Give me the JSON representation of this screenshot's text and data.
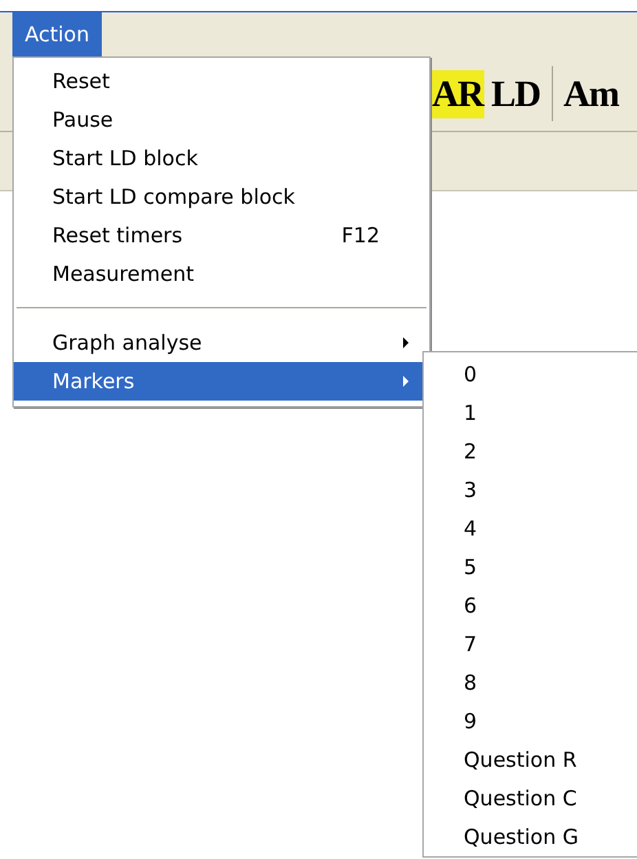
{
  "menubar": [
    {
      "label": "Action",
      "selected": true
    }
  ],
  "toolbar": [
    {
      "label": "AR",
      "highlighted": true
    },
    {
      "label": "LD",
      "highlighted": false
    },
    {
      "kind": "separator"
    },
    {
      "label": "Am",
      "highlighted": false
    }
  ],
  "menu": [
    {
      "kind": "item",
      "label": "Reset",
      "selected": false
    },
    {
      "kind": "item",
      "label": "Pause",
      "selected": false
    },
    {
      "kind": "item",
      "label": "Start LD block",
      "selected": false
    },
    {
      "kind": "item",
      "label": "Start LD compare block",
      "selected": false
    },
    {
      "kind": "item",
      "label": "Reset timers",
      "shortcut": "F12",
      "selected": false
    },
    {
      "kind": "item",
      "label": "Measurement",
      "selected": false
    },
    {
      "kind": "separator"
    },
    {
      "kind": "item",
      "label": "Graph analyse",
      "submenu": true,
      "selected": false
    },
    {
      "kind": "item",
      "label": "Markers",
      "submenu": true,
      "selected": true
    }
  ],
  "submenu": [
    {
      "label": "0"
    },
    {
      "label": "1"
    },
    {
      "label": "2"
    },
    {
      "label": "3"
    },
    {
      "label": "4"
    },
    {
      "label": "5"
    },
    {
      "label": "6"
    },
    {
      "label": "7"
    },
    {
      "label": "8"
    },
    {
      "label": "9"
    },
    {
      "label": "Question R"
    },
    {
      "label": "Question C"
    },
    {
      "label": "Question G"
    }
  ]
}
